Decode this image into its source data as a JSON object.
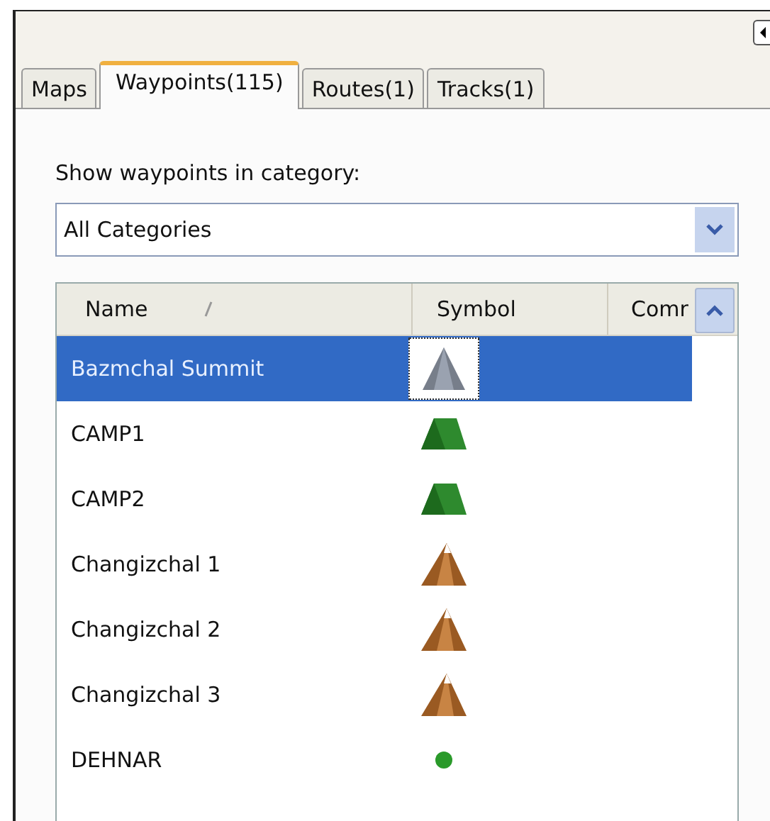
{
  "tabs": [
    {
      "label": "Maps",
      "selected": false
    },
    {
      "label": "Waypoints(115)",
      "selected": true
    },
    {
      "label": "Routes(1)",
      "selected": false
    },
    {
      "label": "Tracks(1)",
      "selected": false
    }
  ],
  "category_label": "Show waypoints in category:",
  "category_dropdown": {
    "value": "All Categories"
  },
  "table": {
    "columns": [
      "Name",
      "Symbol",
      "Comr"
    ],
    "rows": [
      {
        "name": "Bazmchal Summit",
        "kind": "gray-mountain",
        "selected": true
      },
      {
        "name": "CAMP1",
        "kind": "tent",
        "selected": false
      },
      {
        "name": "CAMP2",
        "kind": "tent",
        "selected": false
      },
      {
        "name": "Changizchal 1",
        "kind": "brown-mountain",
        "selected": false
      },
      {
        "name": "Changizchal 2",
        "kind": "brown-mountain",
        "selected": false
      },
      {
        "name": "Changizchal 3",
        "kind": "brown-mountain",
        "selected": false
      },
      {
        "name": "DEHNAR",
        "kind": "green-dot",
        "selected": false
      }
    ]
  }
}
